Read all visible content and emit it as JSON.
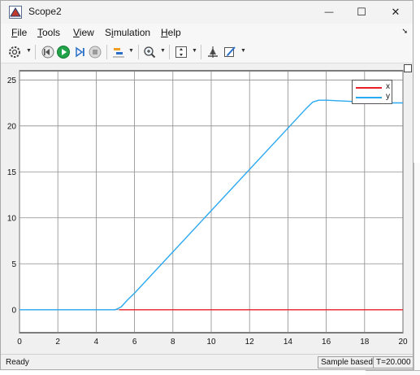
{
  "window": {
    "title": "Scope2",
    "minimize_glyph": "—",
    "maximize_glyph": "☐",
    "close_glyph": "✕"
  },
  "menu": {
    "items": [
      {
        "label_u": "F",
        "label_rest": "ile"
      },
      {
        "label_u": "T",
        "label_rest": "ools"
      },
      {
        "label_u": "V",
        "label_rest": "iew"
      },
      {
        "label_pre": "S",
        "label_u": "i",
        "label_rest": "mulation"
      },
      {
        "label_u": "H",
        "label_rest": "elp"
      }
    ],
    "overflow_glyph": "➘"
  },
  "toolbar": {
    "icons": [
      "gear-icon",
      "step-back-icon",
      "run-icon",
      "step-forward-icon",
      "stop-icon",
      "highlight-icon",
      "zoom-icon",
      "fit-axes-icon",
      "cursor-icon",
      "edit-style-icon"
    ]
  },
  "status": {
    "ready": "Ready",
    "sample_mode": "Sample based",
    "time": "T=20.000"
  },
  "chart_data": {
    "type": "line",
    "title": "",
    "xlabel": "",
    "ylabel": "",
    "xlim": [
      0,
      20
    ],
    "ylim": [
      -2.5,
      26
    ],
    "xticks": [
      0,
      2,
      4,
      6,
      8,
      10,
      12,
      14,
      16,
      18,
      20
    ],
    "yticks": [
      0,
      5,
      10,
      15,
      20,
      25
    ],
    "grid": true,
    "legend_placement": "top-right",
    "series": [
      {
        "name": "x",
        "color": "#e8202a",
        "x": [
          5.2,
          20
        ],
        "y": [
          0,
          0
        ]
      },
      {
        "name": "y",
        "color": "#2aa8f0",
        "x": [
          0,
          5.0,
          5.3,
          5.6,
          6.0,
          15.0,
          15.3,
          15.6,
          16.0,
          17.0,
          18.0,
          19.0,
          20.0
        ],
        "y": [
          0,
          0,
          0.3,
          1.0,
          1.8,
          22.0,
          22.6,
          22.8,
          22.8,
          22.7,
          22.6,
          22.5,
          22.5
        ]
      }
    ]
  }
}
